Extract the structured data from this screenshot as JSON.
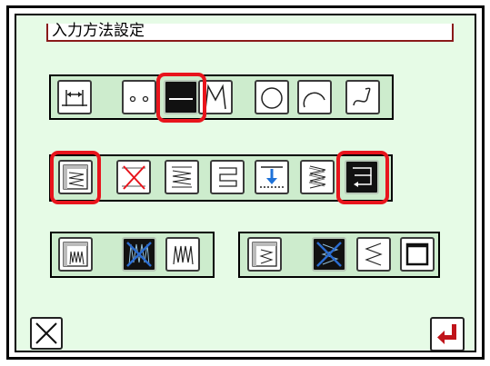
{
  "title": "入力方法設定",
  "colors": {
    "background": "#e6fbe6",
    "panel": "#cdeccd",
    "highlight": "#e8141c",
    "selected": "#111111"
  },
  "rows": {
    "shape": {
      "buttons": [
        "range-icon",
        "point-icon",
        "line-icon",
        "zigzag-icon",
        "circle-icon",
        "arc-icon",
        "curve-icon"
      ],
      "selected": "line-icon"
    },
    "fill": {
      "buttons": [
        "fill-pattern-icon",
        "no-fill-icon",
        "fill-diagonal-icon",
        "fill-step-icon",
        "fill-insert-icon",
        "fill-zigzag-icon",
        "fill-return-icon"
      ],
      "selected": "fill-return-icon"
    },
    "stitch_left": {
      "buttons": [
        "stitch-pattern-icon",
        "no-stitch-icon",
        "stitch-w-icon"
      ]
    },
    "stitch_right": {
      "buttons": [
        "border-pattern-icon",
        "no-border-icon",
        "border-zigzag-icon",
        "border-box-icon"
      ]
    }
  },
  "footer": {
    "cancel_icon": "close-icon",
    "enter_icon": "enter-icon"
  }
}
